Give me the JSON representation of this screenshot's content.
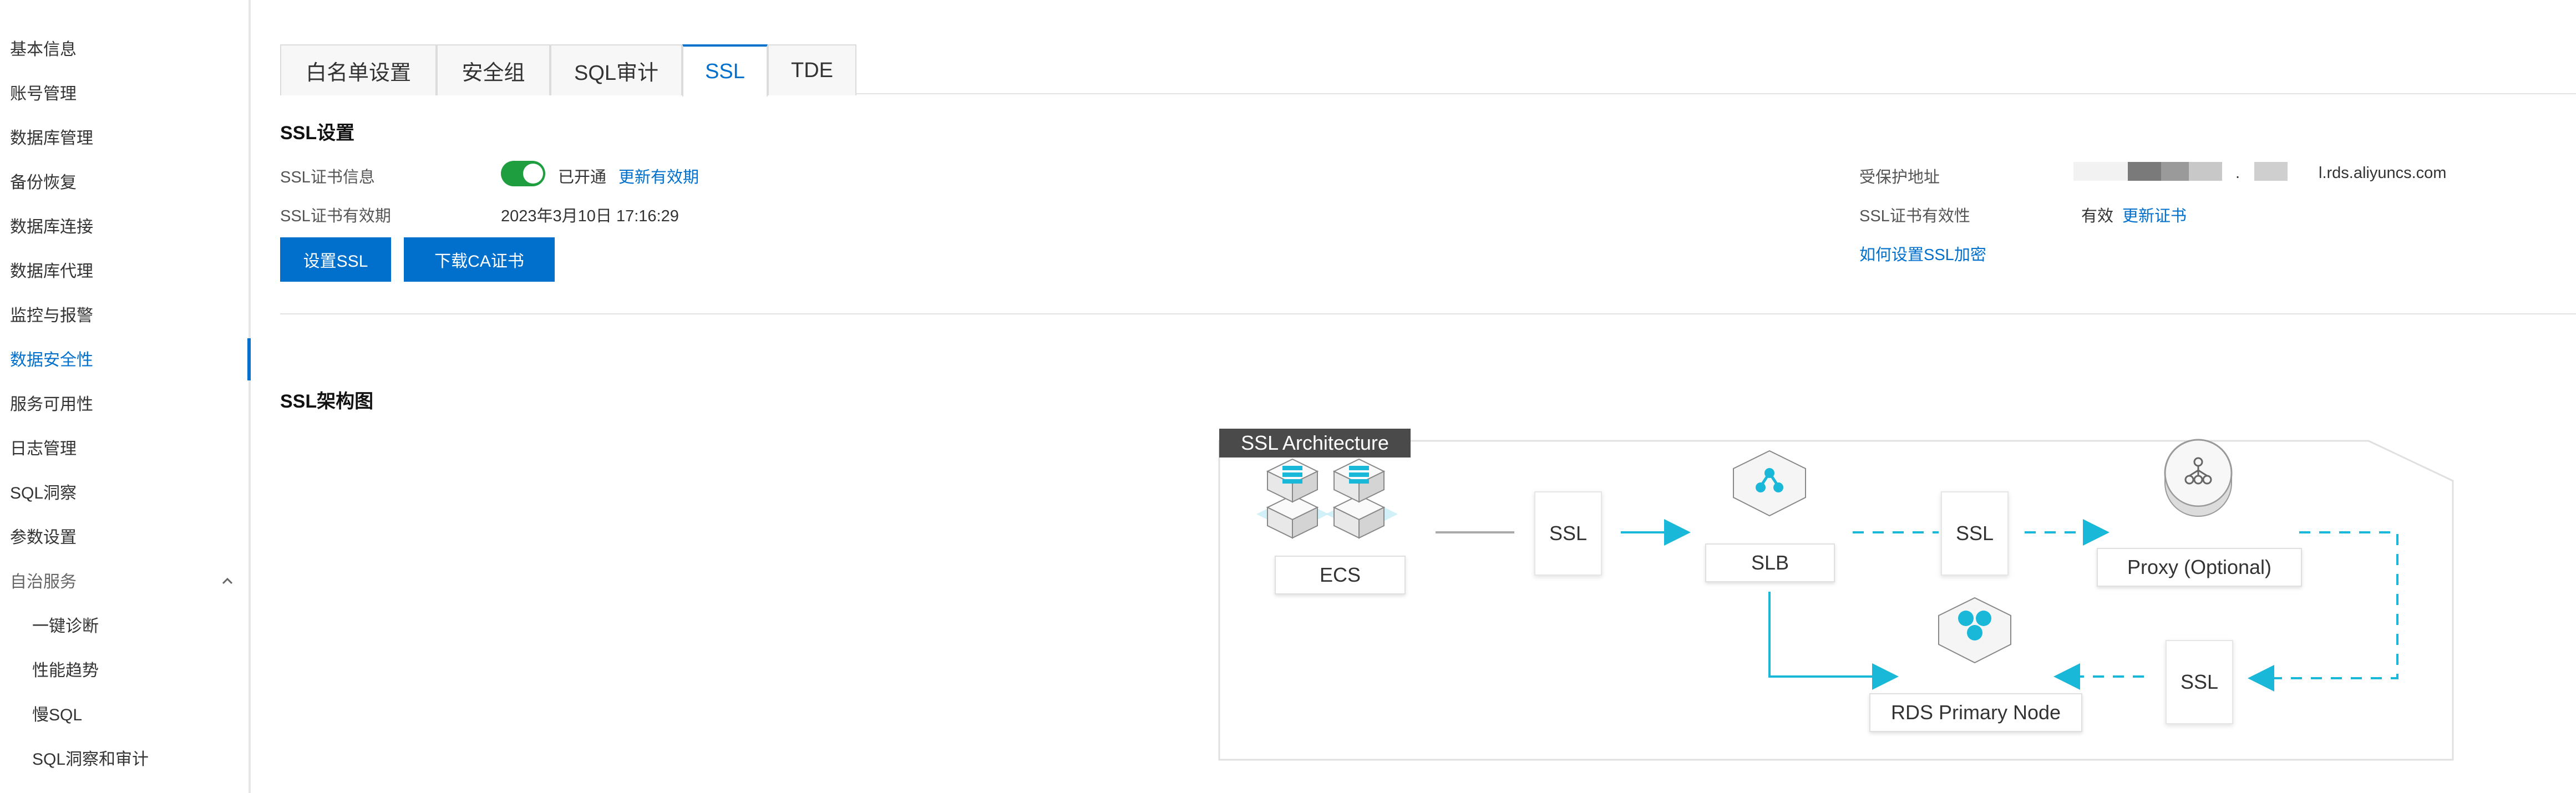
{
  "sidebar": {
    "items": [
      {
        "label": "基本信息"
      },
      {
        "label": "账号管理"
      },
      {
        "label": "数据库管理"
      },
      {
        "label": "备份恢复"
      },
      {
        "label": "数据库连接"
      },
      {
        "label": "数据库代理"
      },
      {
        "label": "监控与报警"
      },
      {
        "label": "数据安全性"
      },
      {
        "label": "服务可用性"
      },
      {
        "label": "日志管理"
      },
      {
        "label": "SQL洞察"
      },
      {
        "label": "参数设置"
      },
      {
        "label": "自治服务"
      },
      {
        "label": "一键诊断"
      },
      {
        "label": "性能趋势"
      },
      {
        "label": "慢SQL"
      },
      {
        "label": "SQL洞察和审计"
      }
    ],
    "active": "数据安全性",
    "accent_color": "#0070cc"
  },
  "tabs": [
    {
      "label": "白名单设置"
    },
    {
      "label": "安全组"
    },
    {
      "label": "SQL审计"
    },
    {
      "label": "SSL"
    },
    {
      "label": "TDE"
    }
  ],
  "active_tab": "SSL",
  "ssl_settings": {
    "title": "SSL设置",
    "cert_info_label": "SSL证书信息",
    "status_text": "已开通",
    "update_validity_link": "更新有效期",
    "validity_label": "SSL证书有效期",
    "validity_value": "2023年3月10日 17:16:29",
    "set_ssl_button": "设置SSL",
    "download_ca_button": "下载CA证书",
    "protected_address_label": "受保护地址",
    "protected_address_separator": ".",
    "protected_address_suffix": "l.rds.aliyuncs.com",
    "cert_validity_label": "SSL证书有效性",
    "cert_validity_value": "有效",
    "update_cert_link": "更新证书",
    "how_to_link": "如何设置SSL加密",
    "switch_on_color": "#1e9e3e"
  },
  "architecture": {
    "section_title": "SSL架构图",
    "diagram_title": "SSL Architecture",
    "ecs_label": "ECS",
    "slb_label": "SLB",
    "proxy_label": "Proxy (Optional)",
    "rds_label": "RDS Primary Node",
    "ssl_label_1": "SSL",
    "ssl_label_2": "SSL",
    "ssl_label_3": "SSL",
    "flow_color": "#19b8d8"
  }
}
